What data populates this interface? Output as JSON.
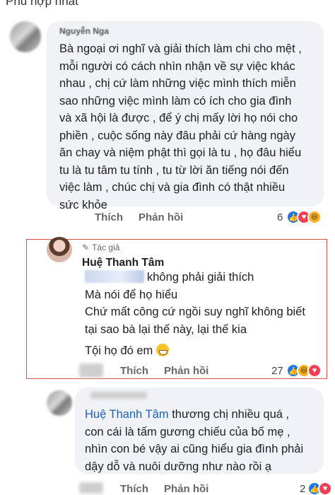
{
  "sort_header": "Phù hợp nhất",
  "comment1": {
    "author": "Nguyễn Nga",
    "text": "Bà ngoại ơi nghĩ và giải thích làm chi cho mệt ,\nmỗi người có cách nhìn nhận về sự việc khác\nnhau , chị cứ làm những việc mình thích miễn\nsao những việc mình làm có ích cho gia đình\nvà xã hội là được , để ý chị mấy lời họ nói cho\nphiền , cuộc sống này đâu phải cứ hàng ngày\năn chay và niệm phật thì gọi là tu , họ đâu hiểu\ntu là tu tâm tu tính , tu từ lời ăn tiếng nói đến\nviệc làm , chúc chị và gia đình có thật nhiều\nsức khỏe",
    "like_label": "Thích",
    "reply_label": "Phản hồi",
    "reaction_count": "6",
    "reactions": [
      "like",
      "love",
      "haha"
    ]
  },
  "reply": {
    "badge": "Tác giả",
    "author": "Huệ Thanh Tâm",
    "lines": [
      "không phải giải thích",
      "Mà nói để họ hiểu",
      "Chứ mất công cứ ngồi suy nghĩ không biết",
      "tại sao bà lại thế này, lại thế kia",
      "Tội họ đó em"
    ],
    "like_label": "Thích",
    "reply_label": "Phản hồi",
    "reaction_count": "27",
    "reactions": [
      "like",
      "haha",
      "love"
    ]
  },
  "comment3": {
    "mention": "Huệ Thanh Tâm",
    "text_after_mention": " thương chị nhiều quá ,",
    "lines": [
      "con cái là tấm gương chiếu của bố mẹ ,",
      "nhìn con bé vậy ai cũng hiểu gia đình phải",
      "dậy dỗ và nuôi dưỡng như nào rồi ạ"
    ],
    "like_label": "Thích",
    "reply_label": "Phản hồi",
    "reaction_count": "2",
    "reactions": [
      "like",
      "love"
    ]
  },
  "colors": {
    "bubble": "#f0f2f5",
    "highlight": "#d9534f",
    "mention": "#1d5fb8",
    "like": "#1877f2",
    "love": "#f33e58",
    "haha": "#f7b125"
  }
}
